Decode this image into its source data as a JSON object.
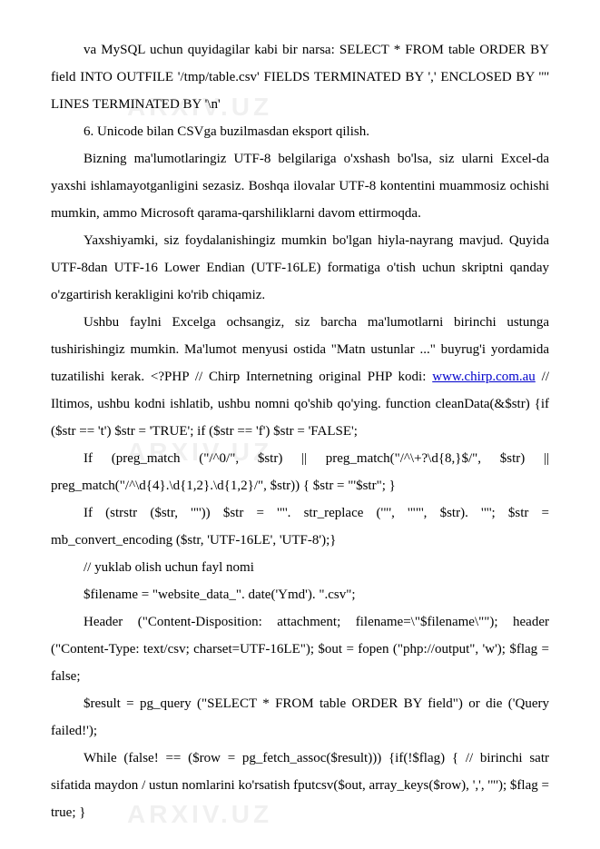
{
  "watermark": "ARXIV.UZ",
  "paragraphs": [
    "va MySQL uchun quyidagilar kabi bir narsa: SELECT * FROM table ORDER BY field INTO OUTFILE '/tmp/table.csv' FIELDS TERMINATED BY ',' ENCLOSED BY '\"' LINES TERMINATED BY '\\n'",
    "6. Unicode bilan CSVga buzilmasdan eksport qilish.",
    "Bizning ma'lumotlaringiz UTF-8 belgilariga o'xshash bo'lsa, siz ularni Excel-da yaxshi ishlamayotganligini sezasiz. Boshqa ilovalar UTF-8 kontentini muammosiz ochishi mumkin, ammo Microsoft qarama-qarshiliklarni davom ettirmoqda.",
    "Yaxshiyamki, siz foydalanishingiz mumkin bo'lgan hiyla-nayrang mavjud. Quyida UTF-8dan UTF-16 Lower Endian (UTF-16LE) formatiga o'tish uchun skriptni qanday o'zgartirish kerakligini ko'rib chiqamiz.",
    "Ushbu faylni Excelga ochsangiz, siz barcha ma'lumotlarni birinchi ustunga tushirishingiz mumkin. Ma'lumot menyusi ostida \"Matn ustunlar ...\" buyrug'i yordamida tuzatilishi kerak. <?PHP // Chirp Internetning original PHP kodi: ",
    " // Iltimos, ushbu kodni ishlatib, ushbu nomni qo'shib qo'ying. function cleanData(&$str) {if ($str == 't') $str = 'TRUE'; if ($str == 'f') $str = 'FALSE';",
    "If (preg_match (\"/^0/\", $str) || preg_match(\"/^\\+?\\d{8,}$/\", $str) || preg_match(\"/^\\d{4}.\\d{1,2}.\\d{1,2}/\", $str)) { $str = \"'$str\"; }",
    "If (strstr ($str, '\"')) $str = '\"'. str_replace ('\"', '\"\"', $str). '\"'; $str = mb_convert_encoding ($str, 'UTF-16LE', 'UTF-8');}",
    "// yuklab olish uchun fayl nomi",
    "$filename = \"website_data_\". date('Ymd'). \".csv\";",
    "Header (\"Content-Disposition: attachment; filename=\\\"$filename\\\"\"); header (\"Content-Type: text/csv; charset=UTF-16LE\"); $out = fopen (\"php://output\", 'w'); $flag = false;",
    "$result = pg_query (\"SELECT * FROM table ORDER BY field\") or die ('Query failed!');",
    "While (false! == ($row = pg_fetch_assoc($result))) {if(!$flag) { // birinchi satr sifatida maydon / ustun nomlarini ko'rsatish fputcsv($out, array_keys($row), ',', '\"'); $flag = true; }"
  ],
  "link": {
    "text": "www.chirp.com.au",
    "paragraph_index_before": 4,
    "paragraph_index_after": 5
  }
}
